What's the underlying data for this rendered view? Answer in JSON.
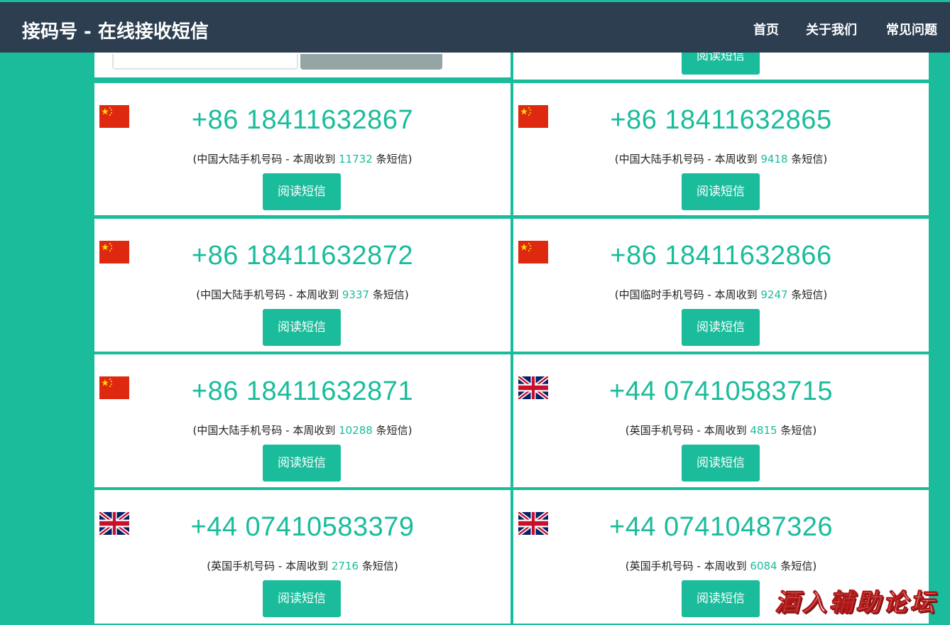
{
  "header": {
    "brand": "接码号 - 在线接收短信",
    "nav": [
      "首页",
      "关于我们",
      "常见问题"
    ]
  },
  "top_partial": {
    "read_button_label": "阅读短信"
  },
  "cards": [
    {
      "flag": "cn-flag",
      "phone": "+86 18411632867",
      "desc_prefix": "(中国大陆手机号码 - 本周收到 ",
      "count": "11732",
      "desc_suffix": " 条短信)",
      "button": "阅读短信"
    },
    {
      "flag": "cn-flag",
      "phone": "+86 18411632865",
      "desc_prefix": "(中国大陆手机号码 - 本周收到 ",
      "count": "9418",
      "desc_suffix": " 条短信)",
      "button": "阅读短信"
    },
    {
      "flag": "cn-flag",
      "phone": "+86 18411632872",
      "desc_prefix": "(中国大陆手机号码 - 本周收到 ",
      "count": "9337",
      "desc_suffix": " 条短信)",
      "button": "阅读短信"
    },
    {
      "flag": "cn-flag",
      "phone": "+86 18411632866",
      "desc_prefix": "(中国临时手机号码 - 本周收到 ",
      "count": "9247",
      "desc_suffix": " 条短信)",
      "button": "阅读短信"
    },
    {
      "flag": "cn-flag",
      "phone": "+86 18411632871",
      "desc_prefix": "(中国大陆手机号码 - 本周收到 ",
      "count": "10288",
      "desc_suffix": " 条短信)",
      "button": "阅读短信"
    },
    {
      "flag": "uk-flag",
      "phone": "+44 07410583715",
      "desc_prefix": "(英国手机号码 - 本周收到 ",
      "count": "4815",
      "desc_suffix": " 条短信)",
      "button": "阅读短信"
    },
    {
      "flag": "uk-flag",
      "phone": "+44 07410583379",
      "desc_prefix": "(英国手机号码 - 本周收到 ",
      "count": "2716",
      "desc_suffix": " 条短信)",
      "button": "阅读短信"
    },
    {
      "flag": "uk-flag",
      "phone": "+44 07410487326",
      "desc_prefix": "(英国手机号码 - 本周收到 ",
      "count": "6084",
      "desc_suffix": " 条短信)",
      "button": "阅读短信"
    }
  ],
  "watermark": "酒入辅助论坛",
  "colors": {
    "accent": "#1abc9c",
    "navbar": "#2c3e50",
    "search_button": "#95a5a6"
  }
}
